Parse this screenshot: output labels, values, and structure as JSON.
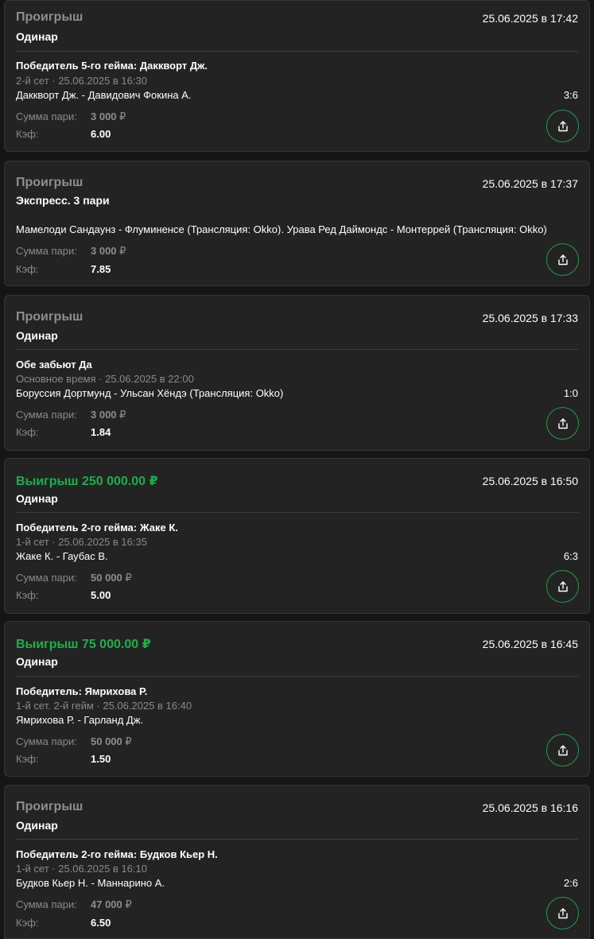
{
  "colors": {
    "background": "#151515",
    "card": "#232323",
    "lost": "#8e8e8e",
    "won": "#19b04a",
    "share_border": "#1f9d4a"
  },
  "labels": {
    "stake": "Сумма пари:",
    "coef": "Кэф:"
  },
  "bets": [
    {
      "status": "Проигрыш",
      "outcome": "lost",
      "datetime": "25.06.2025 в 17:42",
      "type": "Одинар",
      "market": "Победитель 5-го гейма: Даккворт Дж.",
      "meta": "2-й сет · 25.06.2025 в 16:30",
      "event": "Даккворт Дж. - Давидович Фокина А.",
      "score": "3:6",
      "stake_amount": "3 000",
      "currency": "₽",
      "coef": "6.00",
      "share_icon": "share-icon"
    },
    {
      "status": "Проигрыш",
      "outcome": "lost",
      "datetime": "25.06.2025 в 17:37",
      "type": "Экспресс. 3 пари",
      "event": "Мамелоди Сандаунз - Флуминенсе (Трансляция: Okko). Урава Ред Даймондс - Монтеррей (Трансляция: Okko)",
      "stake_amount": "3 000",
      "currency": "₽",
      "coef": "7.85",
      "share_icon": "share-icon"
    },
    {
      "status": "Проигрыш",
      "outcome": "lost",
      "datetime": "25.06.2025 в 17:33",
      "type": "Одинар",
      "market": "Обе забьют Да",
      "meta": "Основное время · 25.06.2025 в 22:00",
      "event": "Боруссия Дортмунд - Ульсан Хёндэ (Трансляция: Okko)",
      "score": "1:0",
      "stake_amount": "3 000",
      "currency": "₽",
      "coef": "1.84",
      "share_icon": "share-icon"
    },
    {
      "status": "Выигрыш 250 000.00 ₽",
      "outcome": "won",
      "datetime": "25.06.2025 в 16:50",
      "type": "Одинар",
      "market": "Победитель 2-го гейма: Жаке К.",
      "meta": "1-й сет · 25.06.2025 в 16:35",
      "event": "Жаке К. - Гаубас В.",
      "score": "6:3",
      "stake_amount": "50 000",
      "currency": "₽",
      "coef": "5.00",
      "share_icon": "share-icon"
    },
    {
      "status": "Выигрыш 75 000.00 ₽",
      "outcome": "won",
      "datetime": "25.06.2025 в 16:45",
      "type": "Одинар",
      "market": "Победитель: Ямрихова Р.",
      "meta": "1-й сет. 2-й гейм · 25.06.2025 в 16:40",
      "event": "Ямрихова Р. - Гарланд Дж.",
      "stake_amount": "50 000",
      "currency": "₽",
      "coef": "1.50",
      "share_icon": "share-icon"
    },
    {
      "status": "Проигрыш",
      "outcome": "lost",
      "datetime": "25.06.2025 в 16:16",
      "type": "Одинар",
      "market": "Победитель 2-го гейма: Будков Кьер Н.",
      "meta": "1-й сет · 25.06.2025 в 16:10",
      "event": "Будков Кьер Н. - Маннарино А.",
      "score": "2:6",
      "stake_amount": "47 000",
      "currency": "₽",
      "coef": "6.50",
      "share_icon": "share-icon"
    }
  ]
}
